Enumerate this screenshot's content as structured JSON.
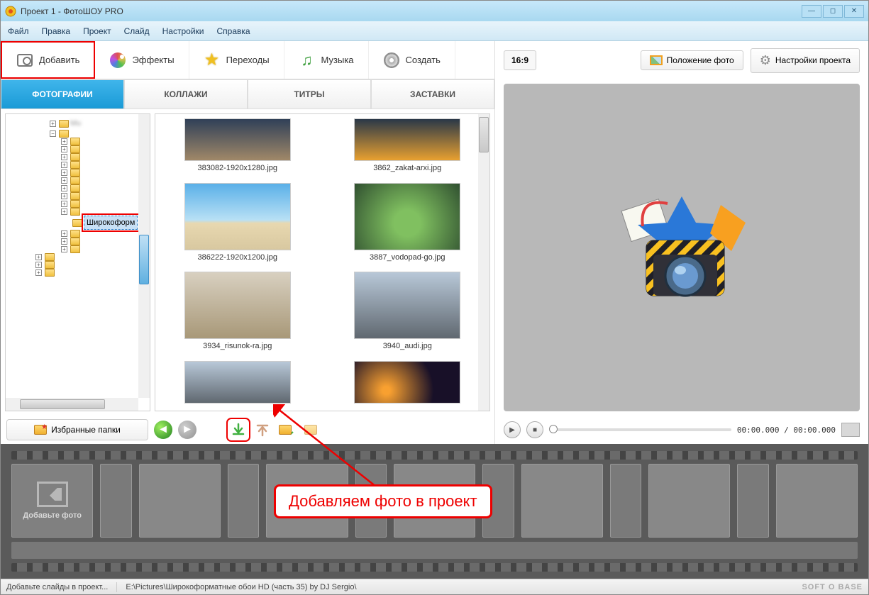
{
  "window": {
    "title": "Проект 1 - ФотоШОУ PRO"
  },
  "menu": {
    "file": "Файл",
    "edit": "Правка",
    "project": "Проект",
    "slide": "Слайд",
    "settings": "Настройки",
    "help": "Справка"
  },
  "toolbar": {
    "add": "Добавить",
    "effects": "Эффекты",
    "transitions": "Переходы",
    "music": "Музыка",
    "create": "Создать"
  },
  "subtabs": {
    "photos": "ФОТОГРАФИИ",
    "collages": "КОЛЛАЖИ",
    "titles": "ТИТРЫ",
    "splash": "ЗАСТАВКИ"
  },
  "tree": {
    "selected": "Широкоформ"
  },
  "thumbnails": [
    "383082-1920x1280.jpg",
    "3862_zakat-arxi.jpg",
    "386222-1920x1200.jpg",
    "3887_vodopad-go.jpg",
    "3934_risunok-ra.jpg",
    "3940_audi.jpg"
  ],
  "fav": {
    "label": "Избранные папки"
  },
  "aspect": "16:9",
  "right_buttons": {
    "position": "Положение фото",
    "settings": "Настройки проекта"
  },
  "transport": {
    "time": "00:00.000 / 00:00.000"
  },
  "timeline": {
    "add_label": "Добавьте фото"
  },
  "status": {
    "hint": "Добавьте слайды в проект...",
    "path": "E:\\Pictures\\Широкоформатные обои HD (часть 35) by DJ Sergio\\",
    "brand": "SOFT O BASE"
  },
  "callout": "Добавляем фото в проект"
}
